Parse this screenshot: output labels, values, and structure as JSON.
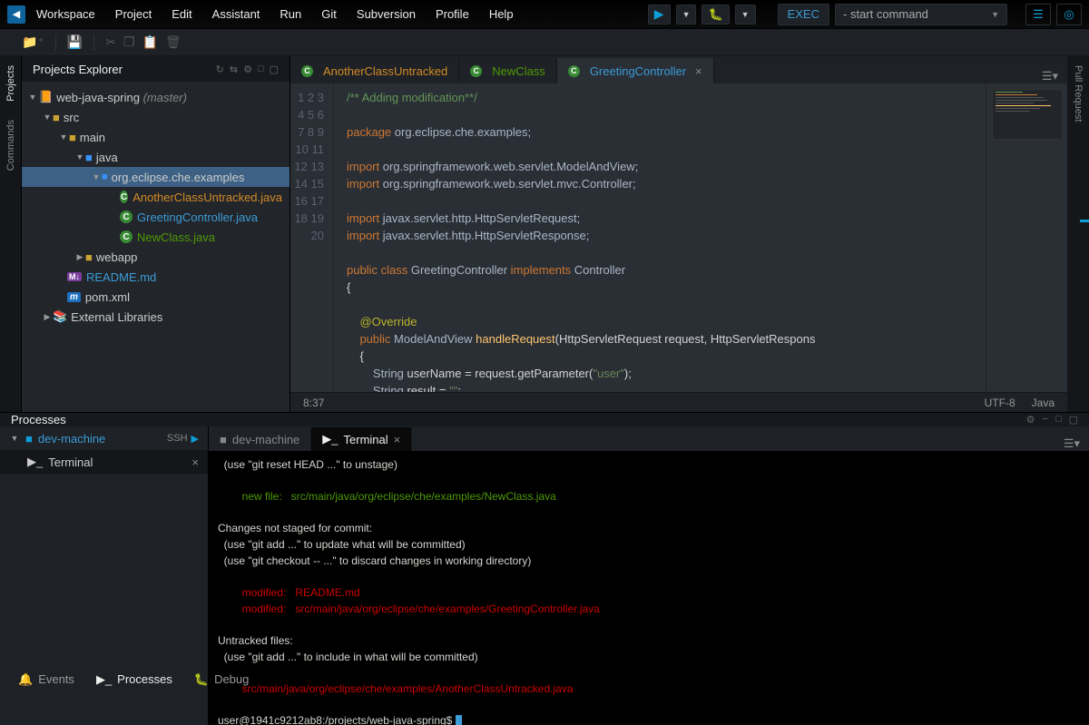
{
  "menu": [
    "Workspace",
    "Project",
    "Edit",
    "Assistant",
    "Run",
    "Git",
    "Subversion",
    "Profile",
    "Help"
  ],
  "exec_label": "EXEC",
  "command_placeholder": "- start command",
  "explorer": {
    "title": "Projects Explorer",
    "project": "web-java-spring",
    "branch": "(master)",
    "src": "src",
    "main": "main",
    "java": "java",
    "package": "org.eclipse.che.examples",
    "files": {
      "f1": "AnotherClassUntracked.java",
      "f2": "GreetingController.java",
      "f3": "NewClass.java"
    },
    "webapp": "webapp",
    "readme": "README.md",
    "pom": "pom.xml",
    "external": "External Libraries"
  },
  "rail": {
    "projects": "Projects",
    "commands": "Commands",
    "pull_request": "Pull Request"
  },
  "tabs": {
    "t1": "AnotherClassUntracked",
    "t2": "NewClass",
    "t3": "GreetingController"
  },
  "code_lines": 20,
  "status": {
    "pos": "8:37",
    "enc": "UTF-8",
    "lang": "Java"
  },
  "processes": {
    "title": "Processes",
    "machine": "dev-machine",
    "ssh": "SSH",
    "terminal": "Terminal",
    "term_tabs": {
      "dev": "dev-machine",
      "term": "Terminal"
    }
  },
  "terminal": {
    "l1": "  (use \"git reset HEAD <file>...\" to unstage)",
    "l2": "        new file:   src/main/java/org/eclipse/che/examples/NewClass.java",
    "l3": "Changes not staged for commit:",
    "l4": "  (use \"git add <file>...\" to update what will be committed)",
    "l5": "  (use \"git checkout -- <file>...\" to discard changes in working directory)",
    "l6": "        modified:   README.md",
    "l7": "        modified:   src/main/java/org/eclipse/che/examples/GreetingController.java",
    "l8": "Untracked files:",
    "l9": "  (use \"git add <file>...\" to include in what will be committed)",
    "l10": "        src/main/java/org/eclipse/che/examples/AnotherClassUntracked.java",
    "prompt": "user@1941c9212ab8:/projects/web-java-spring$ "
  },
  "bottom": {
    "events": "Events",
    "processes": "Processes",
    "debug": "Debug"
  }
}
